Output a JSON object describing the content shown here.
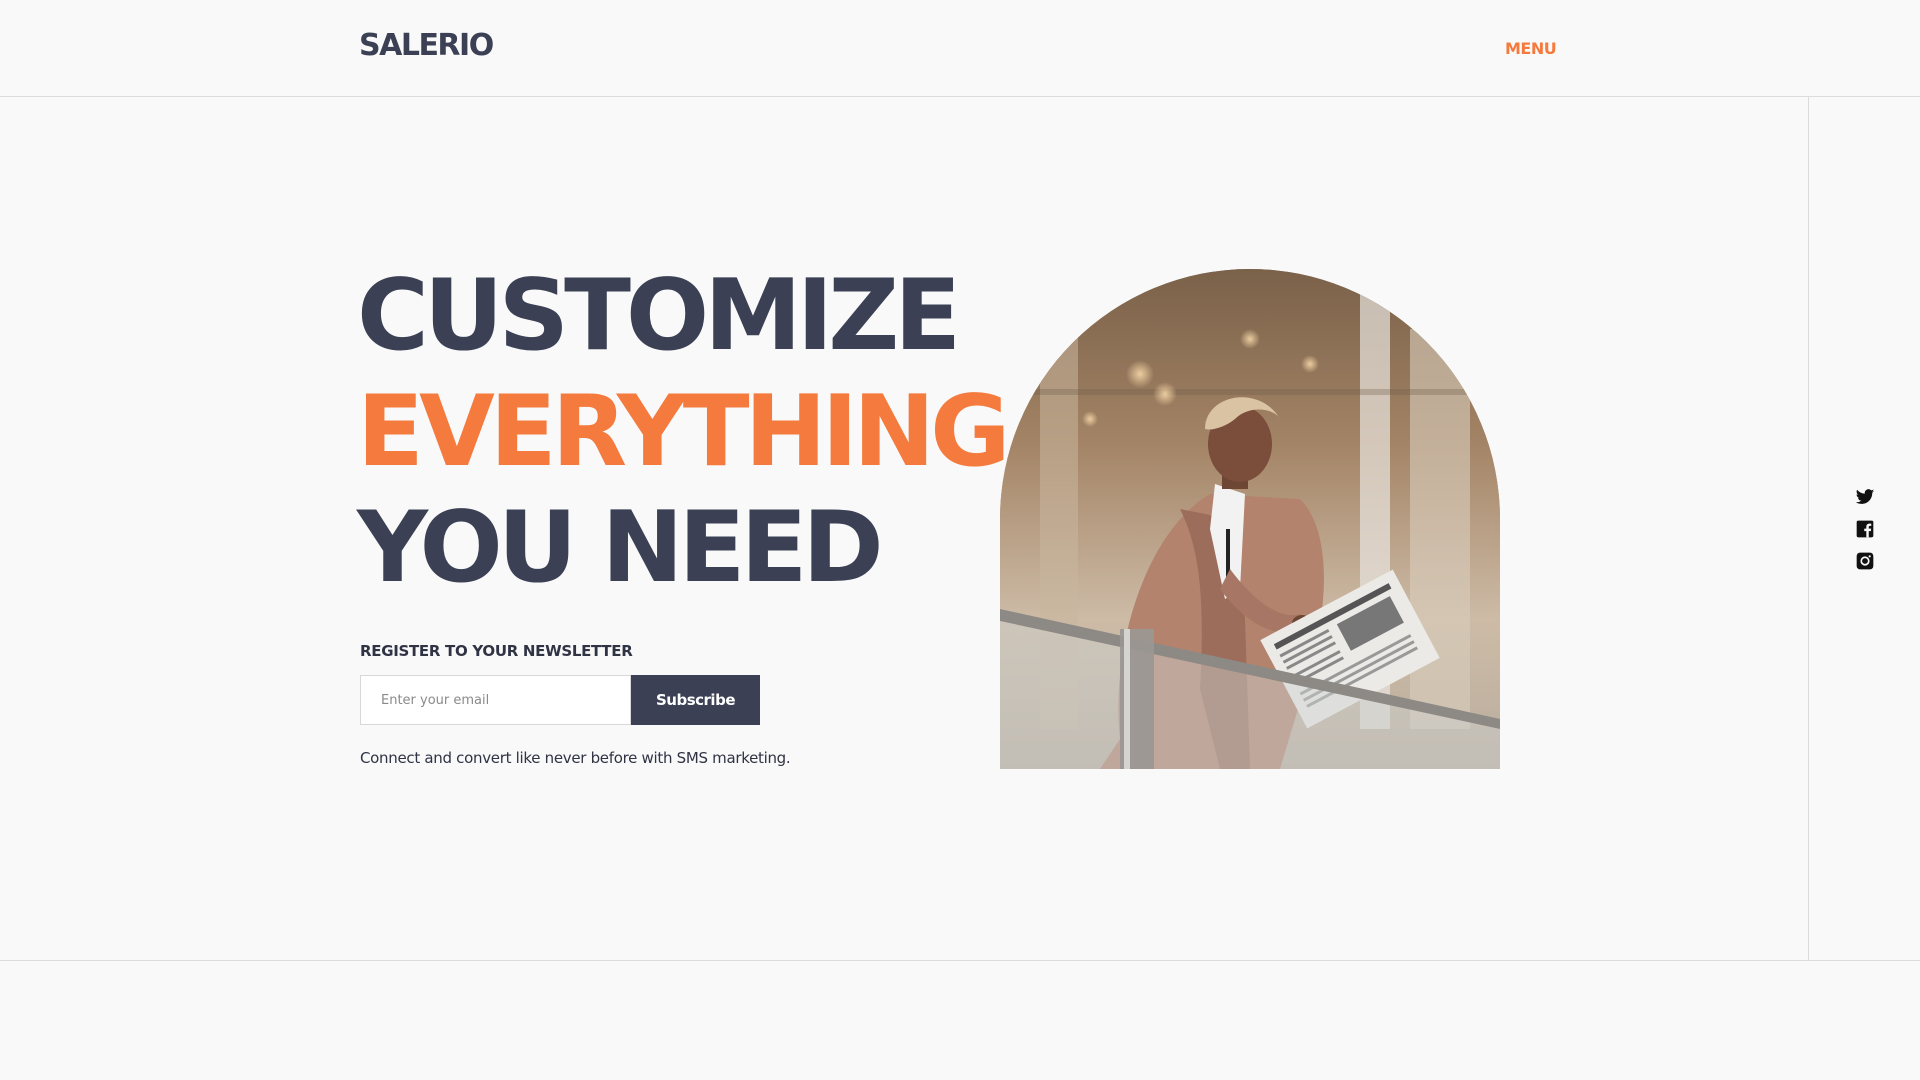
{
  "header": {
    "logo": "SALERIO",
    "menu_label": "MENU"
  },
  "hero": {
    "lines": [
      "CUSTOMIZE",
      "EVERYTHING",
      "YOU NEED"
    ],
    "accent_line_index": 1
  },
  "newsletter": {
    "label": "REGISTER TO YOUR NEWSLETTER",
    "email_placeholder": "Enter your email",
    "email_value": "",
    "button_label": "Subscribe",
    "tagline": "Connect and convert like never before with SMS marketing."
  },
  "photo": {
    "icon": "person-reading-newspaper-photo"
  },
  "social": {
    "icons": [
      "twitter-icon",
      "facebook-icon",
      "instagram-icon"
    ]
  },
  "colors": {
    "accent": "#f47a3d",
    "primary": "#3b4054",
    "background": "#f9f9f9",
    "rule": "#dcdcdc"
  }
}
